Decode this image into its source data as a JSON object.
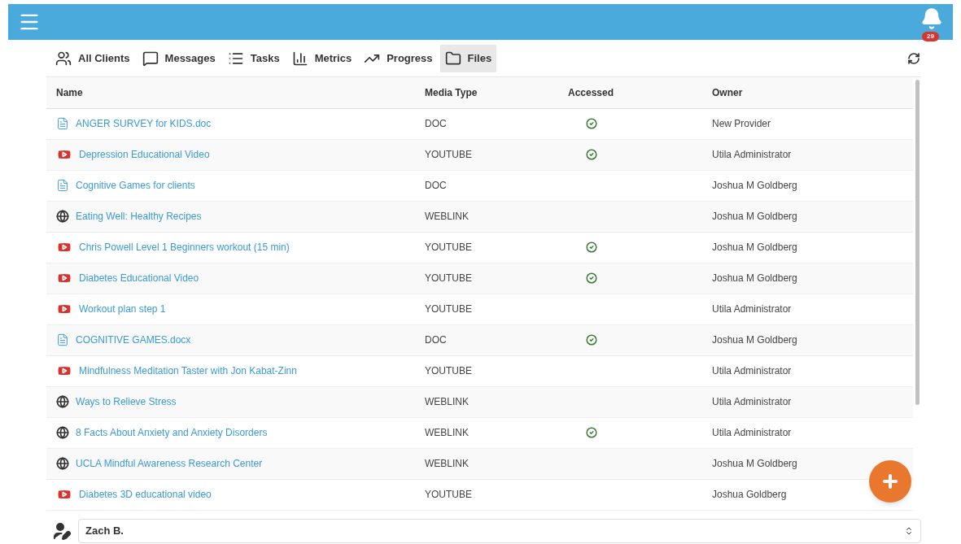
{
  "notifications": {
    "badge": "29"
  },
  "tabs": [
    {
      "label": "All Clients",
      "selected": false
    },
    {
      "label": "Messages",
      "selected": false
    },
    {
      "label": "Tasks",
      "selected": false
    },
    {
      "label": "Metrics",
      "selected": false
    },
    {
      "label": "Progress",
      "selected": false
    },
    {
      "label": "Files",
      "selected": true
    }
  ],
  "table": {
    "columns": [
      "Name",
      "Media Type",
      "Accessed",
      "Owner"
    ],
    "rows": [
      {
        "name": "ANGER SURVEY for KIDS.doc",
        "kind": "doc",
        "media_type": "DOC",
        "accessed": true,
        "owner": "New Provider"
      },
      {
        "name": "Depression Educational Video",
        "kind": "youtube",
        "media_type": "YOUTUBE",
        "accessed": true,
        "owner": "Utila Administrator"
      },
      {
        "name": "Cognitive Games for clients",
        "kind": "doc",
        "media_type": "DOC",
        "accessed": false,
        "owner": "Joshua M Goldberg"
      },
      {
        "name": "Eating Well: Healthy Recipes",
        "kind": "weblink",
        "media_type": "WEBLINK",
        "accessed": false,
        "owner": "Joshua M Goldberg"
      },
      {
        "name": "Chris Powell Level 1 Beginners workout (15 min)",
        "kind": "youtube",
        "media_type": "YOUTUBE",
        "accessed": true,
        "owner": "Joshua M Goldberg"
      },
      {
        "name": "Diabetes Educational Video",
        "kind": "youtube",
        "media_type": "YOUTUBE",
        "accessed": true,
        "owner": "Joshua M Goldberg"
      },
      {
        "name": "Workout plan step 1",
        "kind": "youtube",
        "media_type": "YOUTUBE",
        "accessed": false,
        "owner": "Utila Administrator"
      },
      {
        "name": "COGNITIVE GAMES.docx",
        "kind": "doc",
        "media_type": "DOC",
        "accessed": true,
        "owner": "Joshua M Goldberg"
      },
      {
        "name": "Mindfulness Meditation Taster with Jon Kabat-Zinn",
        "kind": "youtube",
        "media_type": "YOUTUBE",
        "accessed": false,
        "owner": "Utila Administrator"
      },
      {
        "name": "Ways to Relieve Stress",
        "kind": "weblink",
        "media_type": "WEBLINK",
        "accessed": false,
        "owner": "Utila Administrator"
      },
      {
        "name": "8 Facts About Anxiety and Anxiety Disorders",
        "kind": "weblink",
        "media_type": "WEBLINK",
        "accessed": true,
        "owner": "Utila Administrator"
      },
      {
        "name": "UCLA Mindful Awareness Research Center",
        "kind": "weblink",
        "media_type": "WEBLINK",
        "accessed": false,
        "owner": "Joshua M Goldberg"
      },
      {
        "name": "Diabetes 3D educational video",
        "kind": "youtube",
        "media_type": "YOUTUBE",
        "accessed": false,
        "owner": "Joshua Goldberg"
      }
    ]
  },
  "client_select": {
    "value": "Zach B."
  }
}
